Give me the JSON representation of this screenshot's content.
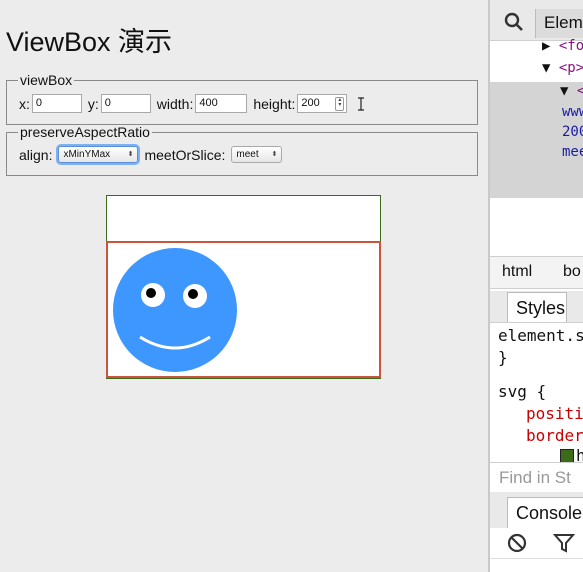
{
  "page": {
    "title": "ViewBox 演示"
  },
  "viewbox": {
    "legend": "viewBox",
    "x_label": "x:",
    "x_value": "0",
    "y_label": "y:",
    "y_value": "0",
    "width_label": "width:",
    "width_value": "400",
    "height_label": "height:",
    "height_value": "200"
  },
  "aspect": {
    "legend": "preserveAspectRatio",
    "align_label": "align:",
    "align_value": "xMinYMax",
    "meet_label": "meetOrSlice:",
    "meet_value": "meet"
  },
  "colors": {
    "face": "#3d97ff",
    "viewbox_border": "#c8553d",
    "svg_border": "#3d6b1c"
  },
  "devtools": {
    "search_icon": "search-icon",
    "elements_tab": "Elem",
    "dom": {
      "line1_tag": "<fo",
      "line2_tag": "<p>",
      "line3_tag": "<",
      "line4_text": "www",
      "line5_text": "200",
      "line6_text": "mee"
    },
    "crumbs": [
      "html",
      "bo"
    ],
    "styles_tab": "Styles",
    "rule1_selector": "element.s",
    "rule1_close": "}",
    "rule2_selector": "svg {",
    "rule2_prop1": "positi",
    "rule2_prop2": "border",
    "rule2_value": "h",
    "find_placeholder": "Find in St",
    "console_tab": "Console",
    "clear_icon": "clear-console-icon",
    "filter_icon": "filter-icon"
  }
}
